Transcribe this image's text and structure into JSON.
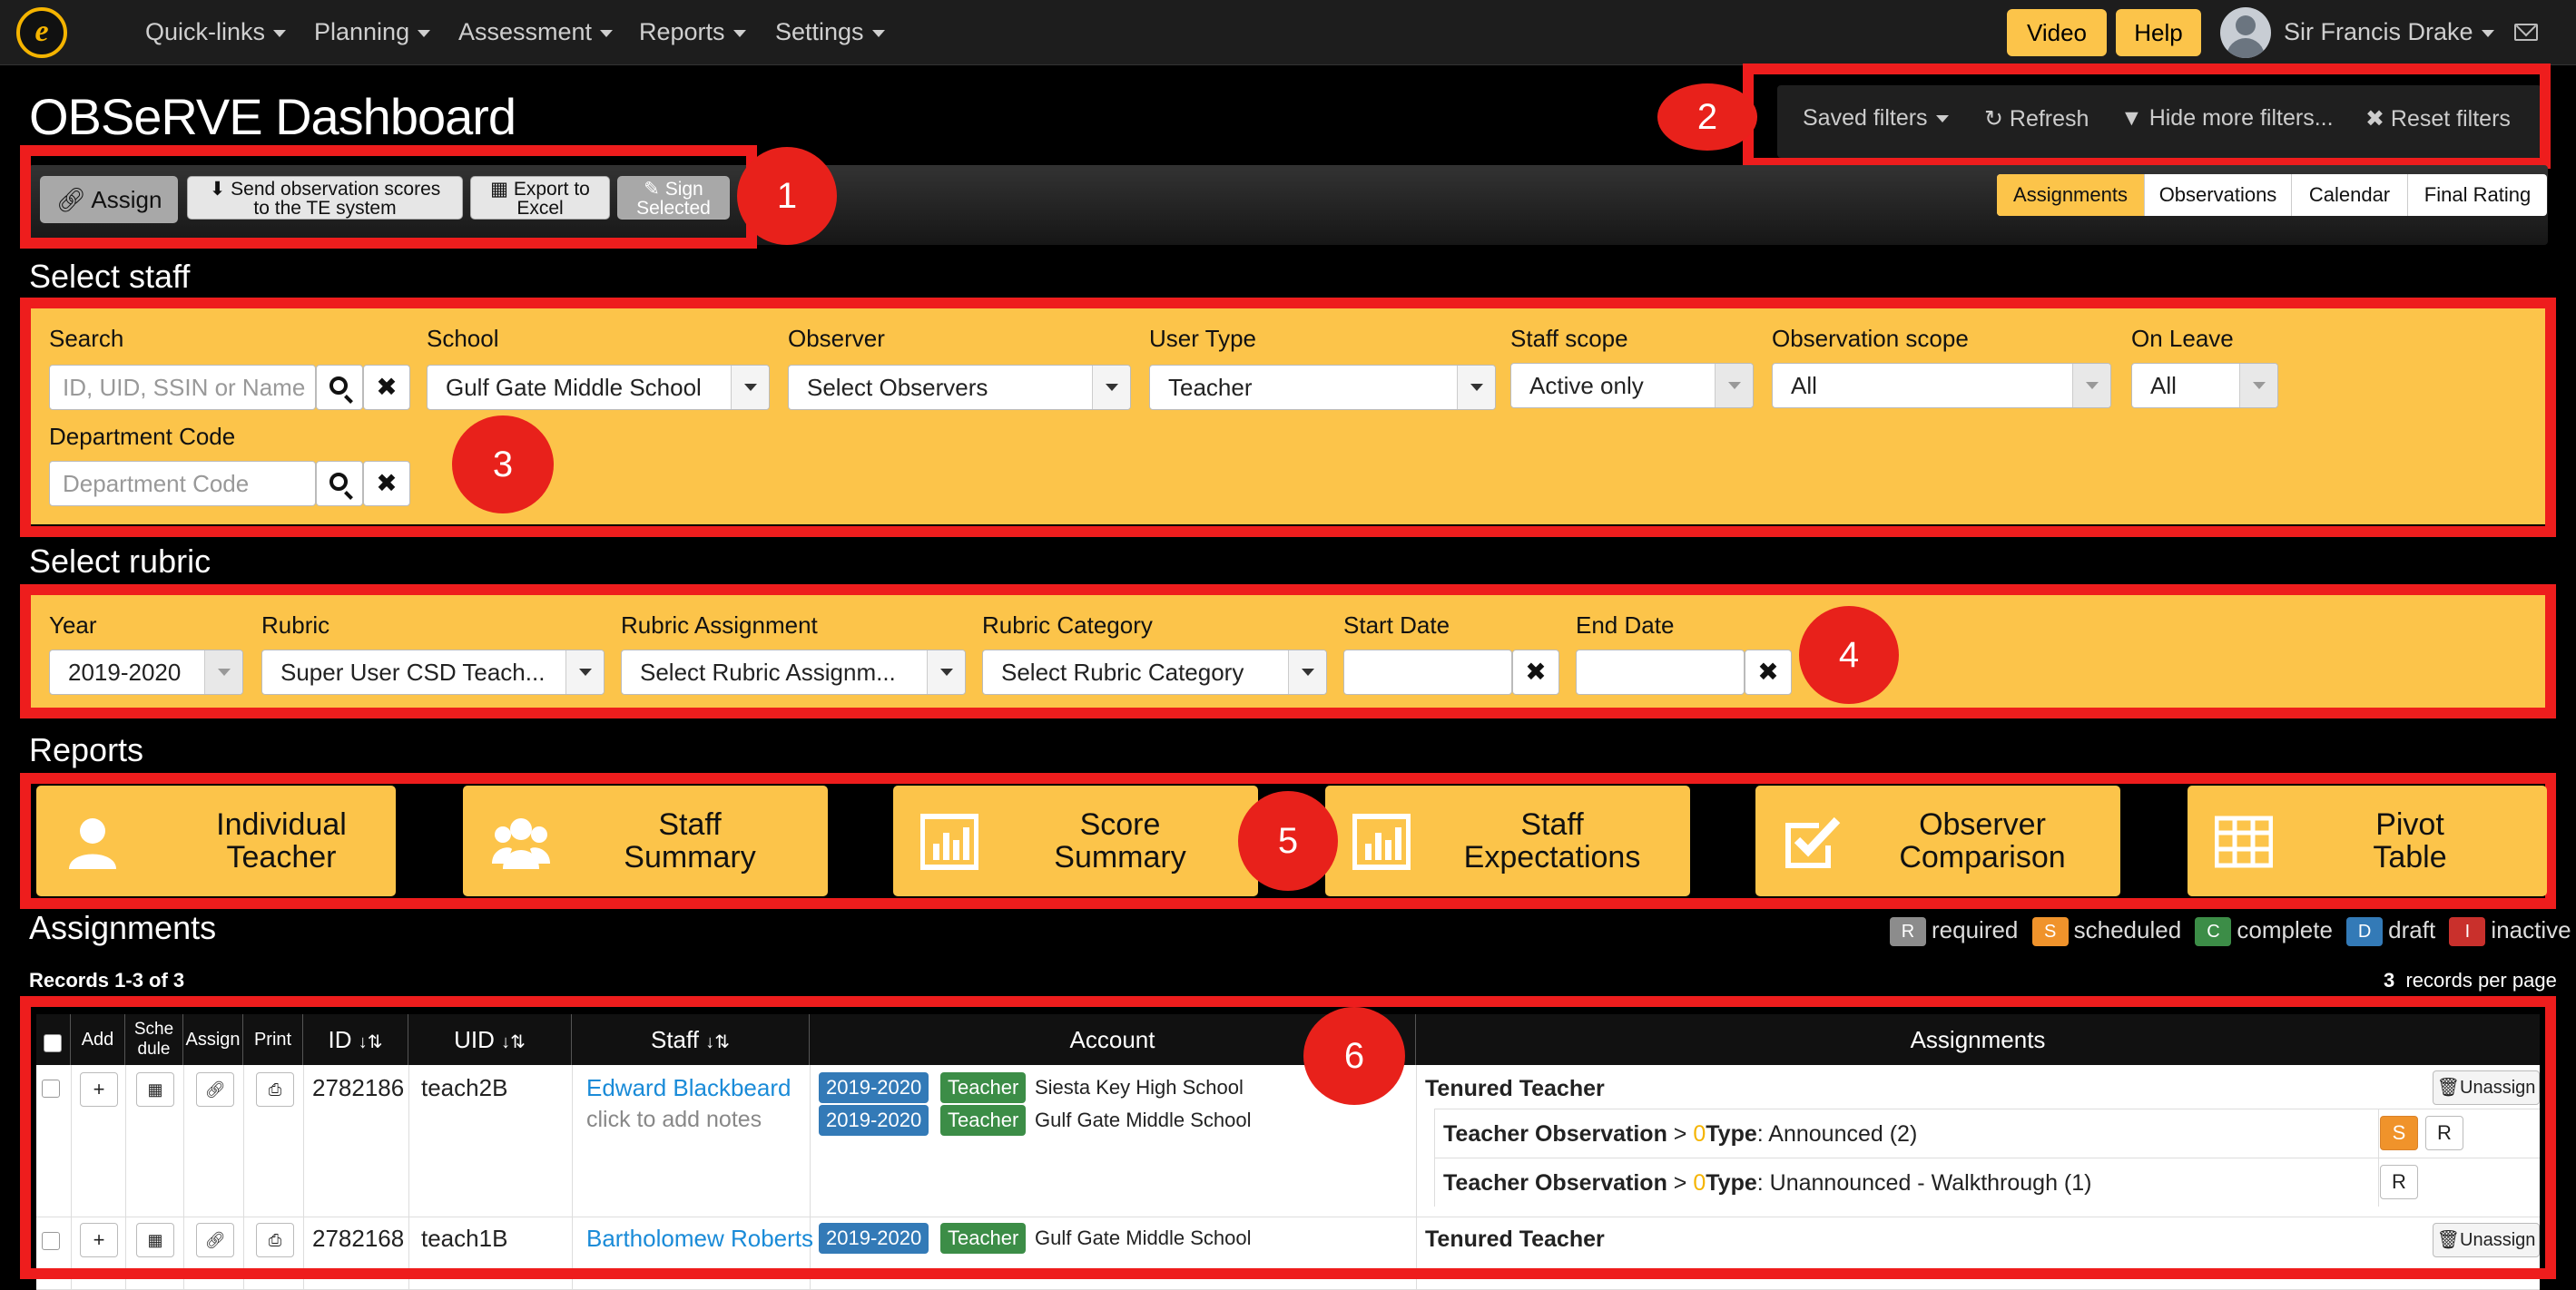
{
  "nav": {
    "logo_letter": "e",
    "menus": [
      "Quick-links",
      "Planning",
      "Assessment",
      "Reports",
      "Settings"
    ],
    "video_label": "Video",
    "help_label": "Help",
    "user_name": "Sir Francis Drake"
  },
  "page_title": "OBSeRVE Dashboard",
  "filters_bar": {
    "saved_filters": "Saved filters",
    "refresh": "Refresh",
    "hide_more_filters": "Hide more filters...",
    "reset_filters": "Reset filters"
  },
  "actions": {
    "assign": "Assign",
    "send_scores_line1": "Send observation scores",
    "send_scores_line2": "to the TE system",
    "export_line1": "Export to",
    "export_line2": "Excel",
    "sign_line1": "Sign",
    "sign_line2": "Selected"
  },
  "view_tabs": [
    "Assignments",
    "Observations",
    "Calendar",
    "Final Rating"
  ],
  "annotations": [
    "1",
    "2",
    "3",
    "4",
    "5",
    "6"
  ],
  "select_staff": {
    "heading": "Select staff",
    "search_label": "Search",
    "search_placeholder": "ID, UID, SSIN or Name",
    "school_label": "School",
    "school_value": "Gulf Gate Middle School",
    "observer_label": "Observer",
    "observer_value": "Select Observers",
    "user_type_label": "User Type",
    "user_type_value": "Teacher",
    "staff_scope_label": "Staff scope",
    "staff_scope_value": "Active only",
    "observation_scope_label": "Observation scope",
    "observation_scope_value": "All",
    "on_leave_label": "On Leave",
    "on_leave_value": "All",
    "dept_label": "Department Code",
    "dept_placeholder": "Department Code"
  },
  "select_rubric": {
    "heading": "Select rubric",
    "year_label": "Year",
    "year_value": "2019-2020",
    "rubric_label": "Rubric",
    "rubric_value": "Super User CSD Teach...",
    "assignment_label": "Rubric Assignment",
    "assignment_value": "Select Rubric Assignm...",
    "category_label": "Rubric Category",
    "category_value": "Select Rubric Category",
    "start_label": "Start Date",
    "end_label": "End Date"
  },
  "reports": {
    "heading": "Reports",
    "tiles": [
      {
        "line1": "Individual",
        "line2": "Teacher",
        "icon": "user-icon"
      },
      {
        "line1": "Staff",
        "line2": "Summary",
        "icon": "users-icon"
      },
      {
        "line1": "Score",
        "line2": "Summary",
        "icon": "bar-chart-icon"
      },
      {
        "line1": "Staff",
        "line2": "Expectations",
        "icon": "bar-chart-icon"
      },
      {
        "line1": "Observer",
        "line2": "Comparison",
        "icon": "check-square-icon"
      },
      {
        "line1": "Pivot",
        "line2": "Table",
        "icon": "table-icon"
      }
    ]
  },
  "assignments": {
    "heading": "Assignments",
    "legend": [
      {
        "code": "R",
        "label": "required",
        "color": "#8c8c8c"
      },
      {
        "code": "S",
        "label": "scheduled",
        "color": "#f0932b"
      },
      {
        "code": "C",
        "label": "complete",
        "color": "#3c8d47"
      },
      {
        "code": "D",
        "label": "draft",
        "color": "#337ab7"
      },
      {
        "code": "I",
        "label": "inactive",
        "color": "#c9302c"
      }
    ],
    "records_info": "Records 1-3 of 3",
    "per_page_count": "3",
    "per_page_label": "records per page",
    "columns": {
      "add": "Add",
      "schedule_1": "Sche",
      "schedule_2": "dule",
      "assign": "Assign",
      "print": "Print",
      "id": "ID",
      "uid": "UID",
      "staff": "Staff",
      "account": "Account",
      "assignments": "Assignments"
    },
    "rows": [
      {
        "id": "2782186",
        "uid": "teach2B",
        "name": "Edward Blackbeard",
        "notes": "click to add notes",
        "accounts": [
          {
            "year": "2019-2020",
            "role": "Teacher",
            "school": "Siesta Key High School"
          },
          {
            "year": "2019-2020",
            "role": "Teacher",
            "school": "Gulf Gate Middle School"
          }
        ],
        "assignment_title": "Tenured Teacher",
        "unassign": "Unassign",
        "items": [
          {
            "obs": "Teacher Observation",
            "sep": " > ",
            "zero": "0",
            "type_label": "Type",
            "type_value": ": Announced (2)",
            "badges": [
              "S",
              "R"
            ]
          },
          {
            "obs": "Teacher Observation",
            "sep": " > ",
            "zero": "0",
            "type_label": "Type",
            "type_value": ": Unannounced - Walkthrough (1)",
            "badges": [
              "R"
            ]
          }
        ]
      },
      {
        "id": "2782168",
        "uid": "teach1B",
        "name": "Bartholomew Roberts",
        "accounts": [
          {
            "year": "2019-2020",
            "role": "Teacher",
            "school": "Gulf Gate Middle School"
          }
        ],
        "assignment_title": "Tenured Teacher",
        "unassign": "Unassign"
      }
    ]
  }
}
